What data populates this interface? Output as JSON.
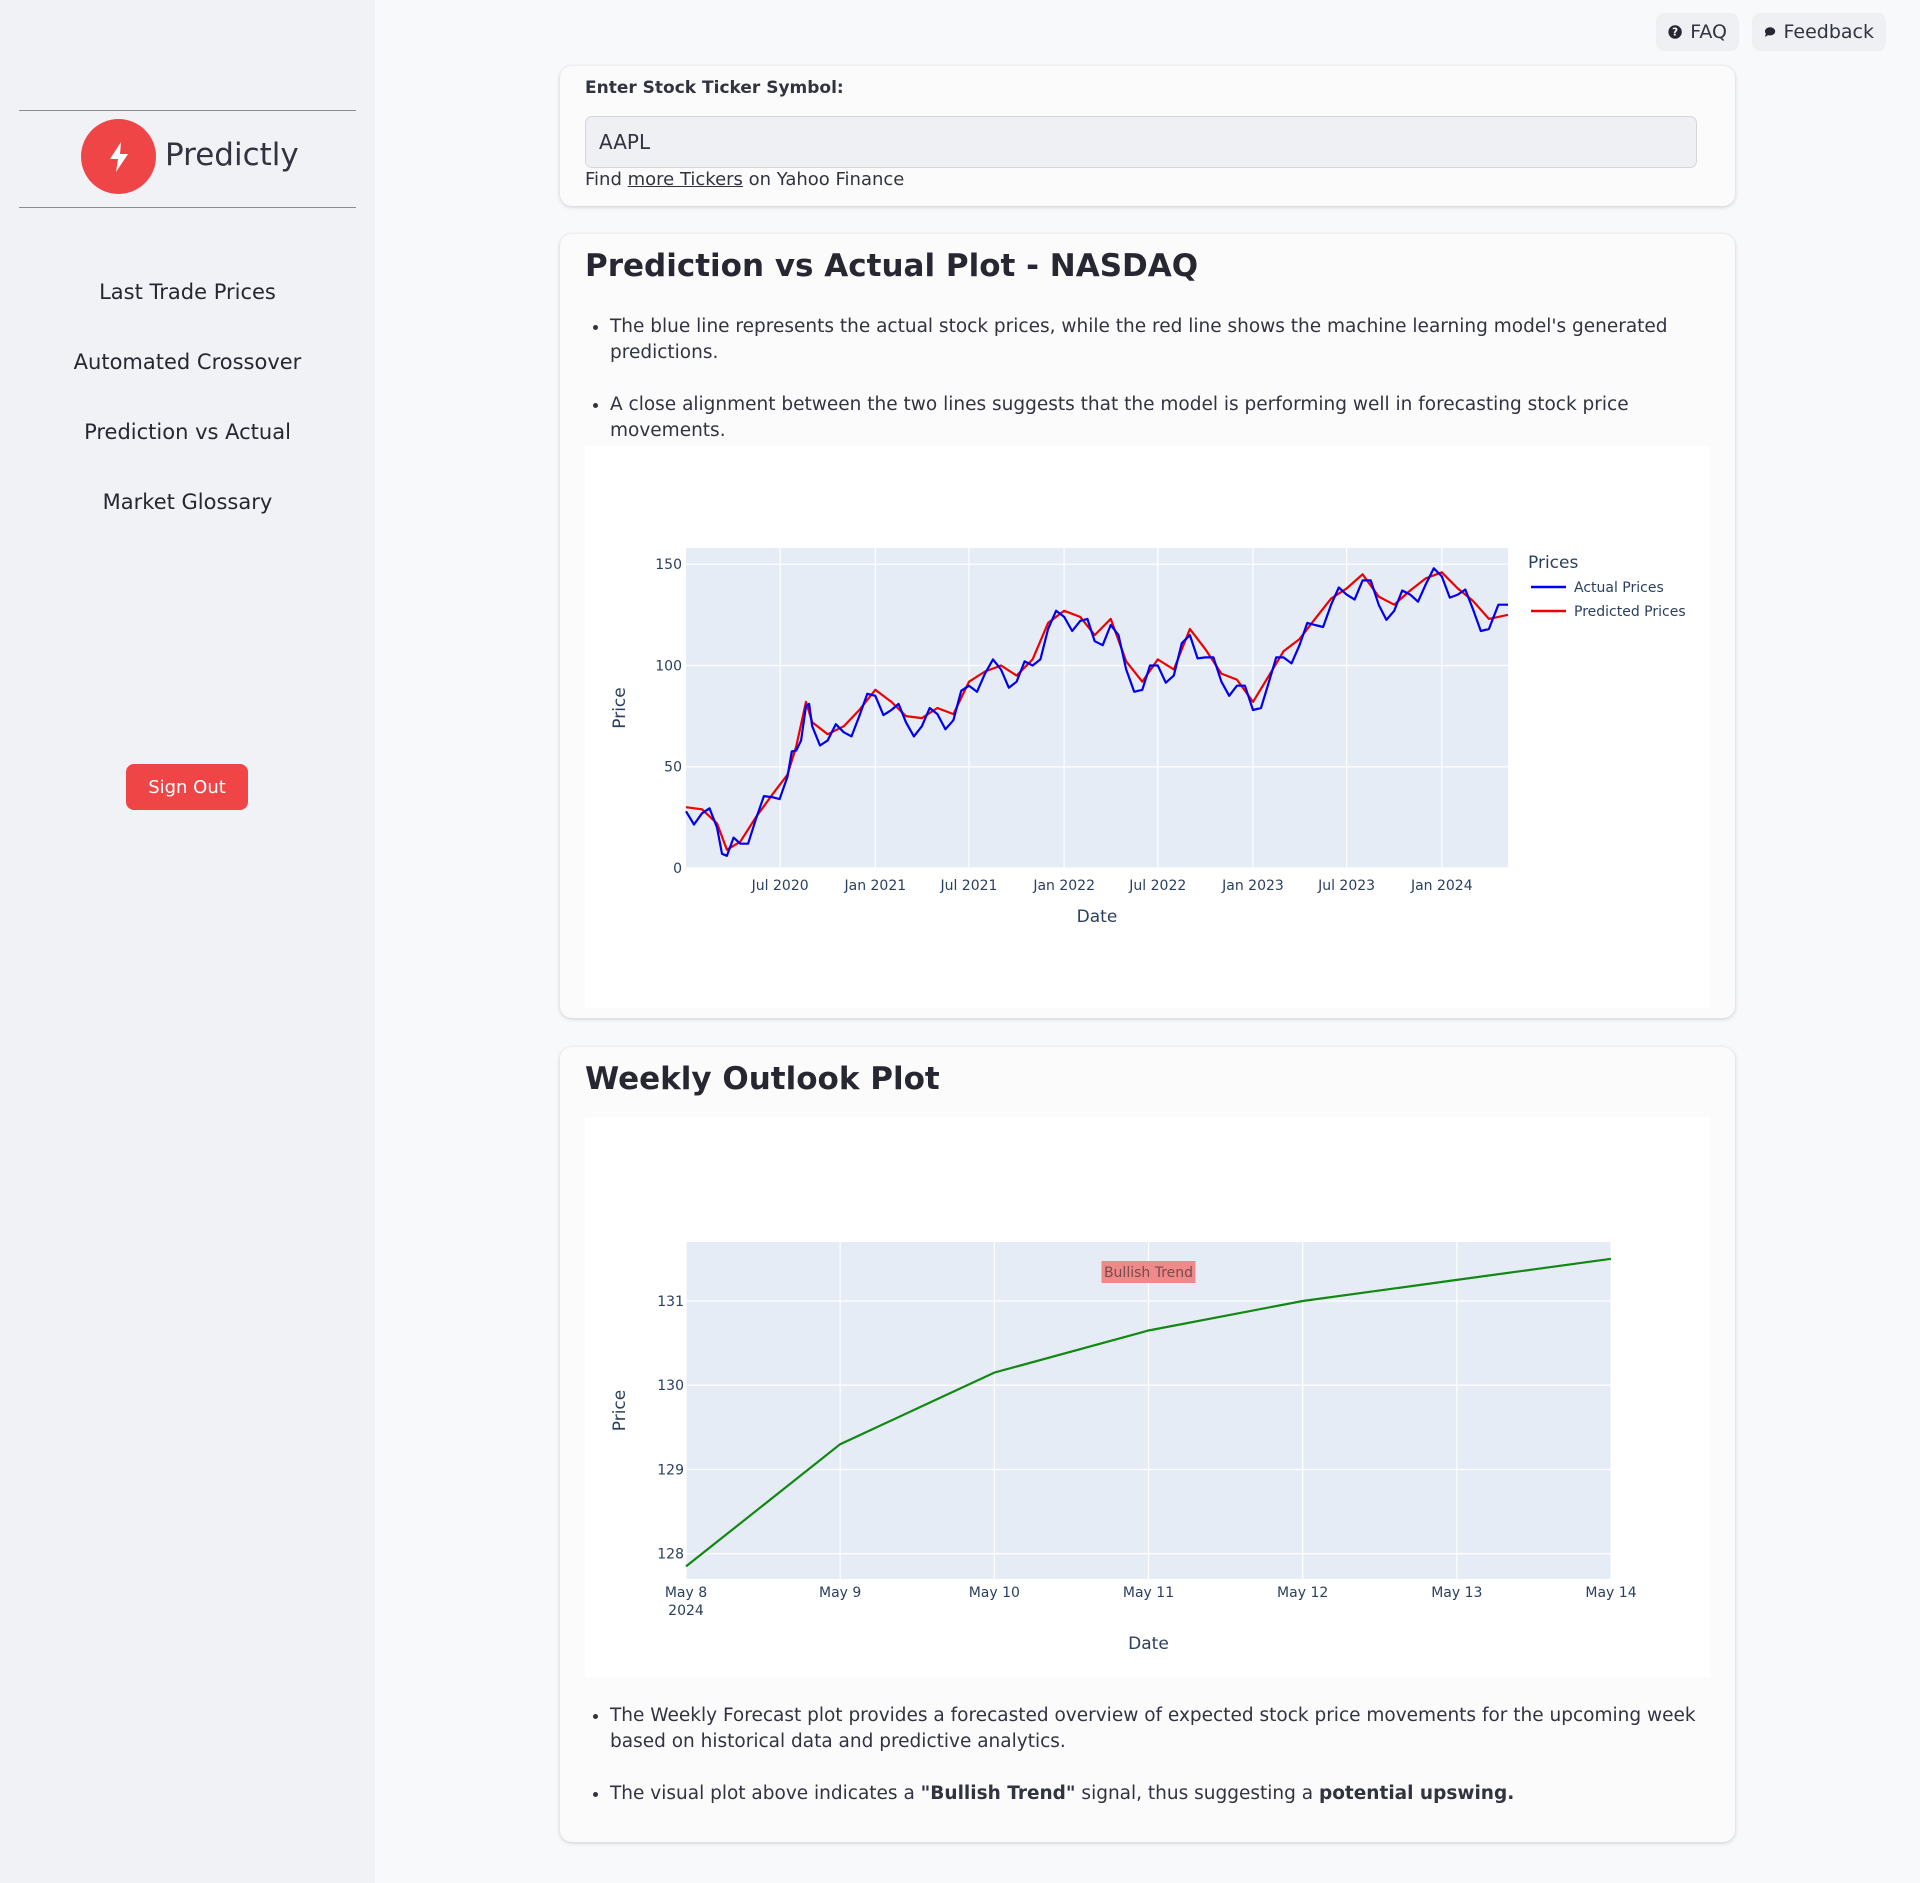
{
  "sidebar": {
    "brand": "Predictly",
    "items": [
      {
        "label": "Last Trade Prices"
      },
      {
        "label": "Automated Crossover"
      },
      {
        "label": "Prediction vs Actual"
      },
      {
        "label": "Market Glossary"
      }
    ],
    "signout_label": "Sign Out"
  },
  "topbar": {
    "faq_label": "FAQ",
    "feedback_label": "Feedback"
  },
  "ticker": {
    "label": "Enter Stock Ticker Symbol:",
    "value": "AAPL",
    "help_prefix": "Find ",
    "help_link": "more Tickers",
    "help_suffix": " on Yahoo Finance"
  },
  "prediction": {
    "title": "Prediction vs Actual Plot - NASDAQ",
    "bullets": [
      "The blue line represents the actual stock prices, while the red line shows the machine learning model's generated predictions.",
      "A close alignment between the two lines suggests that the model is performing well in forecasting stock price movements."
    ]
  },
  "weekly": {
    "title": "Weekly Outlook Plot",
    "bullet1": "The Weekly Forecast plot provides a forecasted overview of expected stock price movements for the upcoming week based on historical data and predictive analytics.",
    "bullet2_pre": "The visual plot above indicates a ",
    "bullet2_bold1": "\"Bullish Trend\"",
    "bullet2_mid": " signal, thus suggesting a ",
    "bullet2_bold2": "potential upswing."
  },
  "colors": {
    "accent": "#f04547",
    "actual": "#0000ee",
    "predicted": "#ee0000",
    "forecast": "#118811",
    "plot_bg": "#e5ecf6"
  },
  "chart_data": [
    {
      "type": "line",
      "xlabel": "Date",
      "ylabel": "Price",
      "ylim": [
        0,
        150
      ],
      "yticks": [
        0,
        50,
        100,
        150
      ],
      "xticks": [
        "Jul 2020",
        "Jan 2021",
        "Jul 2021",
        "Jan 2022",
        "Jul 2022",
        "Jan 2023",
        "Jul 2023",
        "Jan 2024"
      ],
      "x_range": [
        "2020-01-01",
        "2024-05-08"
      ],
      "legend_title": "Prices",
      "legend_position": "top-right",
      "x": [
        "2020-01-01",
        "2020-02-01",
        "2020-03-01",
        "2020-03-20",
        "2020-04-15",
        "2020-05-15",
        "2020-06-15",
        "2020-07-15",
        "2020-08-01",
        "2020-08-20",
        "2020-09-01",
        "2020-10-01",
        "2020-11-01",
        "2020-12-01",
        "2021-01-01",
        "2021-02-01",
        "2021-03-01",
        "2021-04-01",
        "2021-05-01",
        "2021-06-01",
        "2021-07-01",
        "2021-08-01",
        "2021-09-01",
        "2021-10-01",
        "2021-11-01",
        "2021-12-01",
        "2022-01-01",
        "2022-02-01",
        "2022-03-01",
        "2022-04-01",
        "2022-05-01",
        "2022-06-01",
        "2022-07-01",
        "2022-08-01",
        "2022-09-01",
        "2022-10-01",
        "2022-11-01",
        "2022-12-01",
        "2023-01-01",
        "2023-02-01",
        "2023-03-01",
        "2023-04-01",
        "2023-05-01",
        "2023-06-01",
        "2023-07-01",
        "2023-08-01",
        "2023-09-01",
        "2023-10-01",
        "2023-11-01",
        "2023-12-01",
        "2024-01-01",
        "2024-02-01",
        "2024-03-01",
        "2024-04-01",
        "2024-05-08"
      ],
      "series": [
        {
          "name": "Actual Prices",
          "color": "#0000ee",
          "values": [
            28,
            27,
            20,
            6,
            12,
            24,
            35,
            45,
            58,
            80,
            70,
            63,
            67,
            75,
            85,
            78,
            72,
            70,
            76,
            73,
            90,
            96,
            98,
            92,
            100,
            118,
            124,
            122,
            112,
            120,
            98,
            88,
            100,
            95,
            115,
            104,
            92,
            90,
            78,
            92,
            104,
            110,
            120,
            130,
            135,
            142,
            130,
            127,
            135,
            140,
            144,
            135,
            128,
            118,
            130
          ]
        },
        {
          "name": "Predicted Prices",
          "color": "#ee0000",
          "values": [
            30,
            29,
            22,
            9,
            13,
            25,
            36,
            46,
            60,
            82,
            72,
            66,
            70,
            78,
            88,
            82,
            75,
            74,
            79,
            76,
            92,
            97,
            100,
            95,
            103,
            121,
            127,
            124,
            115,
            123,
            102,
            92,
            103,
            98,
            118,
            108,
            96,
            93,
            82,
            95,
            107,
            113,
            123,
            133,
            138,
            145,
            134,
            130,
            137,
            143,
            146,
            138,
            132,
            123,
            125
          ]
        }
      ]
    },
    {
      "type": "line",
      "xlabel": "Date",
      "ylabel": "Price",
      "yticks": [
        128,
        129,
        130,
        131
      ],
      "ylim": [
        127.7,
        131.7
      ],
      "xticks": [
        "May 8",
        "May 9",
        "May 10",
        "May 11",
        "May 12",
        "May 13",
        "May 14"
      ],
      "xtick_sub": "2024",
      "annotation": "Bullish Trend",
      "series": [
        {
          "values": [
            127.85,
            129.3,
            130.15,
            130.65,
            131.0,
            131.25,
            131.5
          ]
        }
      ]
    }
  ]
}
